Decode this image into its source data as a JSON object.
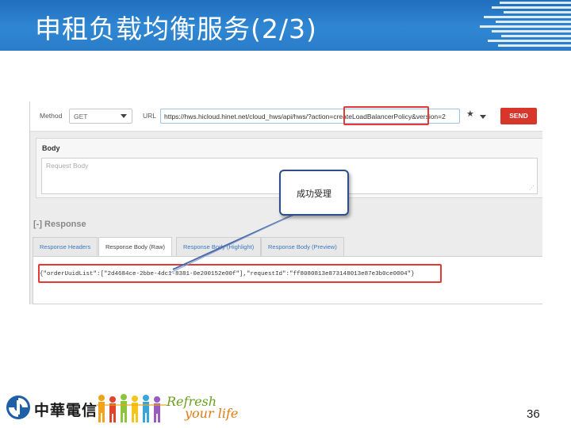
{
  "slide": {
    "title": "申租负载均衡服务(2/3)",
    "page_number": "36",
    "header_color": "#2a7cc8"
  },
  "request": {
    "method_label": "Method",
    "method_value": "GET",
    "url_label": "URL",
    "url_value": "https://hws.hicloud.hinet.net/cloud_hws/api/hws/?action=createLoadBalancerPolicy&version=2",
    "send_label": "SEND",
    "body_title": "Body",
    "body_placeholder": "Request Body"
  },
  "response": {
    "section_title": "[-] Response",
    "tabs": [
      {
        "label": "Response Headers",
        "active": false
      },
      {
        "label": "Response Body (Raw)",
        "active": true
      },
      {
        "label": "Response Body (Highlight)",
        "active": false
      },
      {
        "label": "Response Body (Preview)",
        "active": false
      }
    ],
    "raw_body": "{\"orderUuidList\":[\"2d4684ce-2bbe-4dc1-8381-0e200152e00f\"],\"requestId\":\"ff8080813e873148013e87e3b0ce0004\"}"
  },
  "callout": {
    "text": "成功受理"
  },
  "footer": {
    "company_name": "中華電信",
    "slogan_line1": "Refresh",
    "slogan_line2": "your life"
  },
  "colors": {
    "highlight": "#e53935",
    "send_button": "#d9362b",
    "callout_border": "#2d4e8a"
  },
  "icons": [
    "star-icon",
    "chevron-down-icon",
    "resize-grip-icon",
    "cht-logo-icon"
  ]
}
